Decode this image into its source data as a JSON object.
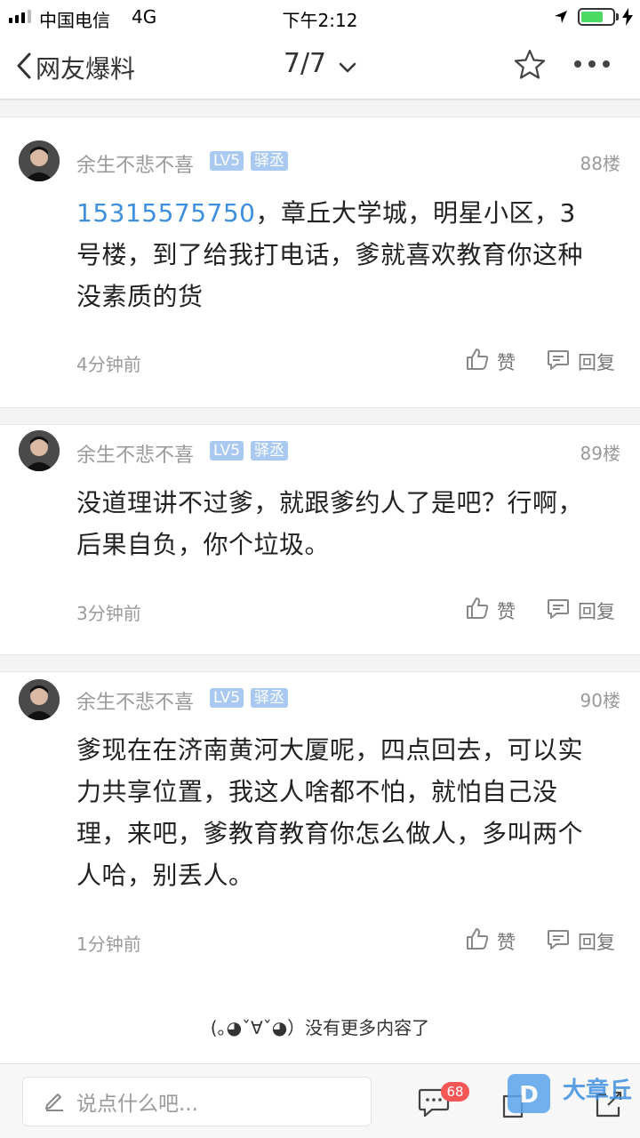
{
  "status_bar": {
    "carrier": "中国电信",
    "network": "4G",
    "time": "下午2:12",
    "battery_level": 0.72
  },
  "nav": {
    "back_label": "网友爆料",
    "page_indicator": "7/7"
  },
  "comments": [
    {
      "username": "余生不悲不喜",
      "level": "LV5",
      "title": "驿丞",
      "floor": "88楼",
      "phone": "15315575750",
      "text": "，章丘大学城，明星小区，3号楼，到了给我打电话，爹就喜欢教育你这种没素质的货",
      "time": "4分钟前",
      "like_label": "赞",
      "reply_label": "回复"
    },
    {
      "username": "余生不悲不喜",
      "level": "LV5",
      "title": "驿丞",
      "floor": "89楼",
      "text": "没道理讲不过爹，就跟爹约人了是吧？行啊，后果自负，你个垃圾。",
      "time": "3分钟前",
      "like_label": "赞",
      "reply_label": "回复"
    },
    {
      "username": "余生不悲不喜",
      "level": "LV5",
      "title": "驿丞",
      "floor": "90楼",
      "text": "爹现在在济南黄河大厦呢，四点回去，可以实力共享位置，我这人啥都不怕，就怕自己没理，来吧，爹教育教育你怎么做人，多叫两个人哈，别丢人。",
      "time": "1分钟前",
      "like_label": "赞",
      "reply_label": "回复"
    }
  ],
  "end_note": "(｡◕ˇ∀ˇ◕）没有更多内容了",
  "bottom_bar": {
    "input_placeholder": "说点什么吧...",
    "comment_count": "68"
  },
  "watermark": {
    "text": "大章丘"
  },
  "colors": {
    "link": "#3f8fe0",
    "badge": "#a9c9f0",
    "count_badge": "#f55656",
    "battery": "#4cd964"
  }
}
